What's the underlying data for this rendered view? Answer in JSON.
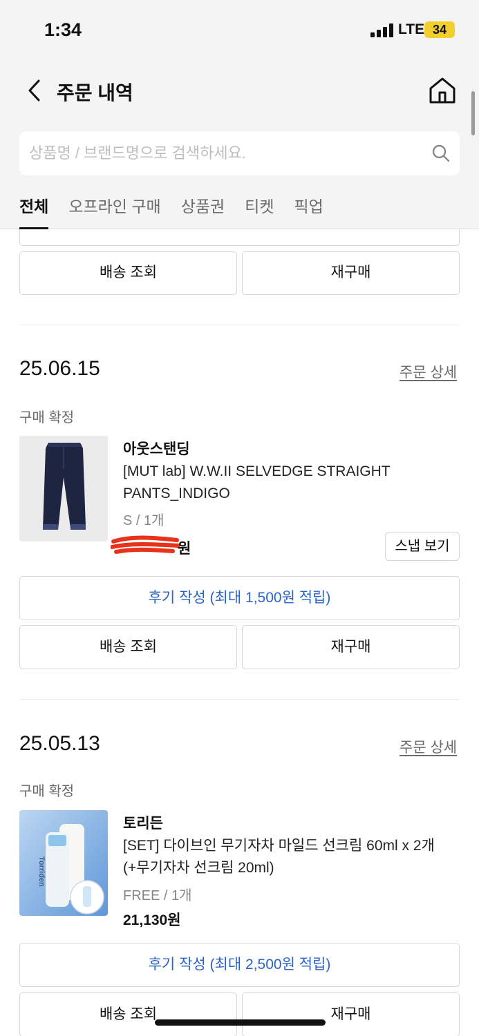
{
  "status_bar": {
    "time": "1:34",
    "network": "LTE",
    "battery": "34"
  },
  "nav": {
    "title": "주문 내역"
  },
  "search": {
    "placeholder": "상품명 / 브랜드명으로 검색하세요."
  },
  "tabs": [
    {
      "label": "전체",
      "active": true
    },
    {
      "label": "오프라인 구매",
      "active": false
    },
    {
      "label": "상품권",
      "active": false
    },
    {
      "label": "티켓",
      "active": false
    },
    {
      "label": "픽업",
      "active": false
    }
  ],
  "prev_order": {
    "track_label": "배송 조회",
    "rebuy_label": "재구매"
  },
  "orders": [
    {
      "date": "25.06.15",
      "detail_label": "주문 상세",
      "status": "구매 확정",
      "brand": "아웃스탠딩",
      "product_name": "[MUT lab] W.W.II SELVEDGE STRAIGHT PANTS_INDIGO",
      "option": "S / 1개",
      "price": "원",
      "snap_label": "스냅 보기",
      "review_label": "후기 작성 (최대 1,500원 적립)",
      "track_label": "배송 조회",
      "rebuy_label": "재구매"
    },
    {
      "date": "25.05.13",
      "detail_label": "주문 상세",
      "status": "구매 확정",
      "brand": "토리든",
      "product_name": "[SET] 다이브인 무기자차 마일드 선크림 60ml x 2개 (+무기자차 선크림 20ml)",
      "option": "FREE / 1개",
      "price": "21,130원",
      "review_label": "후기 작성 (최대 2,500원 적립)",
      "track_label": "배송 조회",
      "rebuy_label": "재구매",
      "thumb_text": "Torriden"
    }
  ]
}
